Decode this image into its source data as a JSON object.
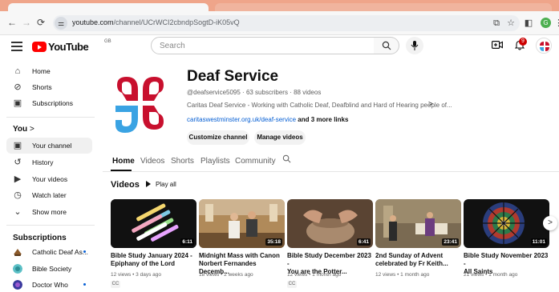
{
  "browser": {
    "url_host": "youtube.com",
    "url_path": "/channel/UCrWCI2cbndpSogtD-iK05vQ"
  },
  "masthead": {
    "logo_text": "YouTube",
    "country_code": "GB",
    "search_placeholder": "Search",
    "notification_count": "9"
  },
  "sidebar": {
    "main": [
      {
        "label": "Home",
        "icon": "home-icon"
      },
      {
        "label": "Shorts",
        "icon": "shorts-icon"
      },
      {
        "label": "Subscriptions",
        "icon": "subscriptions-icon"
      }
    ],
    "you_heading": "You",
    "you_chevron": ">",
    "you": [
      {
        "label": "Your channel",
        "icon": "channel-icon",
        "active": true
      },
      {
        "label": "History",
        "icon": "history-icon"
      },
      {
        "label": "Your videos",
        "icon": "your-videos-icon"
      },
      {
        "label": "Watch later",
        "icon": "watch-later-icon"
      },
      {
        "label": "Show more",
        "icon": "chevron-down-icon"
      }
    ],
    "subscriptions_heading": "Subscriptions",
    "subscriptions": [
      {
        "label": "Catholic Deaf As...",
        "new": true,
        "color": "#8b5a2b"
      },
      {
        "label": "Bible Society",
        "new": false,
        "color": "#5cc0c6"
      },
      {
        "label": "Doctor Who",
        "new": true,
        "color": "#3a3a9e"
      }
    ]
  },
  "channel": {
    "name": "Deaf Service",
    "meta": "@deafservice5095 · 63 subscribers · 88 videos",
    "description": "Caritas Deaf Service - Working with Catholic Deaf, Deafblind and Hard of Hearing people of...",
    "desc_more": ">",
    "link": "caritaswestminster.org.uk/deaf-service",
    "more_links": "and 3 more links",
    "customize_label": "Customize channel",
    "manage_label": "Manage videos"
  },
  "tabs": [
    "Home",
    "Videos",
    "Shorts",
    "Playlists",
    "Community"
  ],
  "videos_section": {
    "title": "Videos",
    "play_all": "Play all",
    "next": ">"
  },
  "videos": [
    {
      "title_line1": "Bible Study January 2024 -",
      "title_line2": "Epiphany of the Lord",
      "duration": "6:11",
      "meta": "12 views • 3 days ago",
      "cc": "CC"
    },
    {
      "title_line1": "Midnight Mass with Canon",
      "title_line2": "Norbert Fernandes Decemb...",
      "duration": "35:18",
      "meta": "18 views • 2 weeks ago",
      "cc": ""
    },
    {
      "title_line1": "Bible Study December 2023 -",
      "title_line2": "You are the Potter...",
      "duration": "6:41",
      "meta": "12 views • 1 month ago",
      "cc": "CC"
    },
    {
      "title_line1": "2nd Sunday of Advent",
      "title_line2": "celebrated by Fr Keith...",
      "duration": "23:41",
      "meta": "12 views • 1 month ago",
      "cc": ""
    },
    {
      "title_line1": "Bible Study November 2023 -",
      "title_line2": "All Saints",
      "duration": "11:01",
      "meta": "21 views • 1 month ago",
      "cc": ""
    }
  ],
  "colors": {
    "brand_red": "#ff0000",
    "logo_red": "#c8102e",
    "logo_blue": "#3aa3e3",
    "link_blue": "#065fd4"
  }
}
